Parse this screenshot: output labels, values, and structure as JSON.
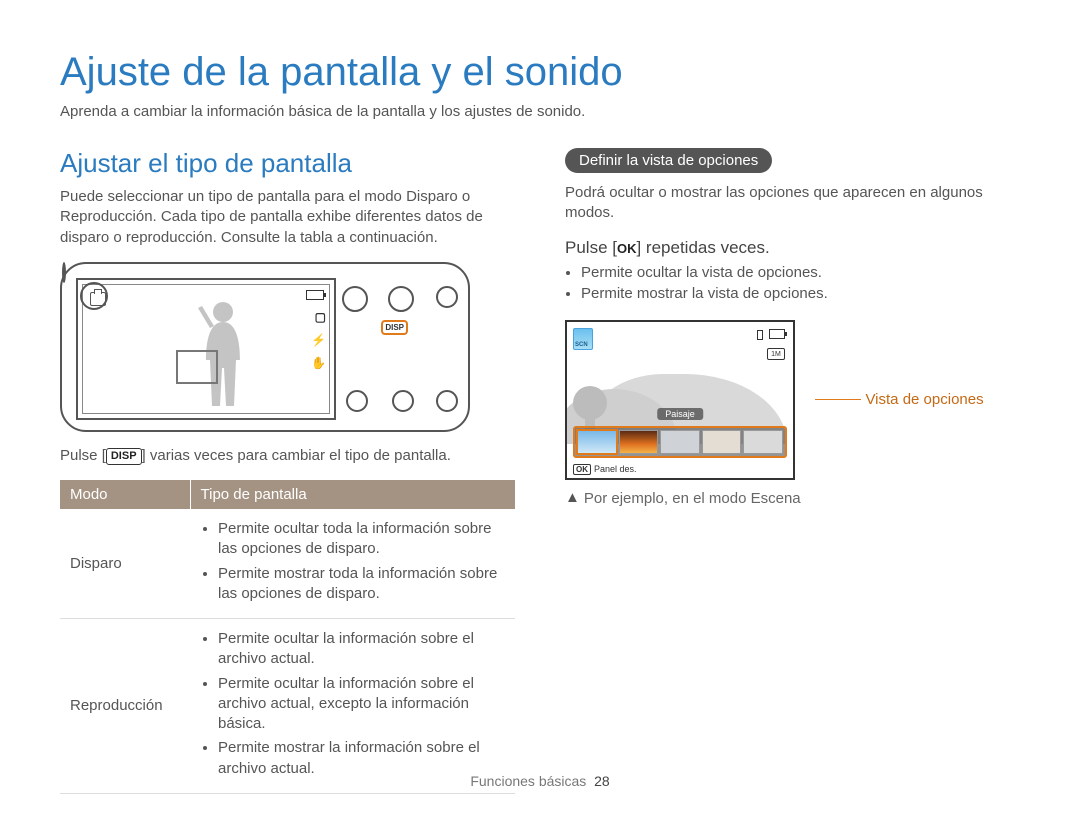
{
  "title": "Ajuste de la pantalla y el sonido",
  "intro": "Aprenda a cambiar la información básica de la pantalla y los ajustes de sonido.",
  "left": {
    "heading": "Ajustar el tipo de pantalla",
    "para": "Puede seleccionar un tipo de pantalla para el modo Disparo o Reproducción. Cada tipo de pantalla exhibe diferentes datos de disparo o reproducción. Consulte la tabla a continuación.",
    "disp_badge": "DISP",
    "disp_line_pre": "Pulse [",
    "disp_line_post": "] varias veces para cambiar el tipo de pantalla.",
    "table": {
      "head_mode": "Modo",
      "head_type": "Tipo de pantalla",
      "rows": [
        {
          "mode": "Disparo",
          "items": [
            "Permite ocultar toda la información sobre las opciones de disparo.",
            "Permite mostrar toda la información sobre las opciones de disparo."
          ]
        },
        {
          "mode": "Reproducción",
          "items": [
            "Permite ocultar la información sobre el archivo actual.",
            "Permite ocultar la información sobre el archivo actual, excepto la información básica.",
            "Permite mostrar la información sobre el archivo actual."
          ]
        }
      ]
    }
  },
  "right": {
    "pill": "Definir la vista de opciones",
    "para": "Podrá ocultar o mostrar las opciones que aparecen en algunos modos.",
    "pulse_pre": "Pulse [",
    "ok_label": "OK",
    "pulse_post": "] repetidas veces.",
    "bullets": [
      "Permite ocultar la vista de opciones.",
      "Permite mostrar la vista de opciones."
    ],
    "lcd": {
      "res": "1M",
      "paisaje": "Paisaje",
      "panel": "Panel des.",
      "ok": "OK"
    },
    "callout": "Vista de opciones",
    "example": "Por ejemplo, en el modo Escena"
  },
  "footer": {
    "section": "Funciones básicas",
    "page": "28"
  }
}
